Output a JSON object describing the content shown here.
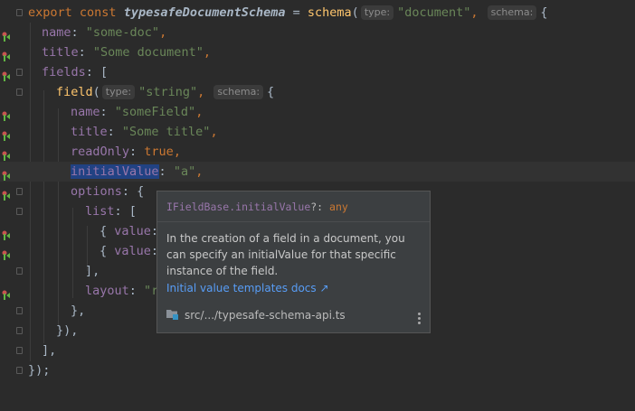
{
  "code_lines": [
    {
      "tokens": [
        {
          "t": "export ",
          "c": "kw"
        },
        {
          "t": "const ",
          "c": "kw"
        },
        {
          "t": "typesafeDocumentSchema",
          "c": "fn-italic"
        },
        {
          "t": " = ",
          "c": "plain"
        },
        {
          "t": "schema",
          "c": "fn"
        },
        {
          "t": "(",
          "c": "plain"
        },
        {
          "t": "type:",
          "c": "hint"
        },
        {
          "t": "\"document\"",
          "c": "str"
        },
        {
          "t": ", ",
          "c": "kw"
        },
        {
          "t": "schema:",
          "c": "hint"
        },
        {
          "t": "{",
          "c": "plain"
        }
      ]
    },
    {
      "tokens": [
        {
          "t": "name",
          "c": "prop"
        },
        {
          "t": ": ",
          "c": "plain"
        },
        {
          "t": "\"some-doc\"",
          "c": "str"
        },
        {
          "t": ",",
          "c": "kw"
        }
      ]
    },
    {
      "tokens": [
        {
          "t": "title",
          "c": "prop"
        },
        {
          "t": ": ",
          "c": "plain"
        },
        {
          "t": "\"Some document\"",
          "c": "str"
        },
        {
          "t": ",",
          "c": "kw"
        }
      ]
    },
    {
      "tokens": [
        {
          "t": "fields",
          "c": "prop"
        },
        {
          "t": ": [",
          "c": "plain"
        }
      ]
    },
    {
      "tokens": [
        {
          "t": "field",
          "c": "fn"
        },
        {
          "t": "(",
          "c": "plain"
        },
        {
          "t": "type:",
          "c": "hint"
        },
        {
          "t": "\"string\"",
          "c": "str"
        },
        {
          "t": ", ",
          "c": "kw"
        },
        {
          "t": "schema:",
          "c": "hint"
        },
        {
          "t": "{",
          "c": "plain"
        }
      ]
    },
    {
      "tokens": [
        {
          "t": "name",
          "c": "prop"
        },
        {
          "t": ": ",
          "c": "plain"
        },
        {
          "t": "\"someField\"",
          "c": "str"
        },
        {
          "t": ",",
          "c": "kw"
        }
      ]
    },
    {
      "tokens": [
        {
          "t": "title",
          "c": "prop"
        },
        {
          "t": ": ",
          "c": "plain"
        },
        {
          "t": "\"Some title\"",
          "c": "str"
        },
        {
          "t": ",",
          "c": "kw"
        }
      ]
    },
    {
      "tokens": [
        {
          "t": "readOnly",
          "c": "prop"
        },
        {
          "t": ": ",
          "c": "plain"
        },
        {
          "t": "true",
          "c": "kw"
        },
        {
          "t": ",",
          "c": "kw"
        }
      ]
    },
    {
      "tokens": [
        {
          "t": "initialValue",
          "c": "prop sel"
        },
        {
          "t": ": ",
          "c": "plain"
        },
        {
          "t": "\"a\"",
          "c": "str"
        },
        {
          "t": ",",
          "c": "kw"
        }
      ]
    },
    {
      "tokens": [
        {
          "t": "options",
          "c": "prop"
        },
        {
          "t": ": {",
          "c": "plain"
        }
      ]
    },
    {
      "tokens": [
        {
          "t": "list",
          "c": "prop"
        },
        {
          "t": ": [",
          "c": "plain"
        }
      ]
    },
    {
      "tokens": [
        {
          "t": "{ ",
          "c": "plain"
        },
        {
          "t": "value",
          "c": "prop"
        },
        {
          "t": ":",
          "c": "plain"
        }
      ]
    },
    {
      "tokens": [
        {
          "t": "{ ",
          "c": "plain"
        },
        {
          "t": "value",
          "c": "prop"
        },
        {
          "t": ":",
          "c": "plain"
        }
      ]
    },
    {
      "tokens": [
        {
          "t": "],",
          "c": "plain"
        }
      ]
    },
    {
      "tokens": [
        {
          "t": "layout",
          "c": "prop"
        },
        {
          "t": ": ",
          "c": "plain"
        },
        {
          "t": "\"r",
          "c": "str"
        }
      ]
    },
    {
      "tokens": [
        {
          "t": "},",
          "c": "plain"
        }
      ]
    },
    {
      "tokens": [
        {
          "t": "}),",
          "c": "plain"
        }
      ]
    },
    {
      "tokens": [
        {
          "t": "],",
          "c": "plain"
        }
      ]
    },
    {
      "tokens": [
        {
          "t": "});",
          "c": "plain"
        }
      ]
    }
  ],
  "popup": {
    "signature_name": "IFieldBase.initialValue",
    "signature_sep": "?: ",
    "signature_type": "any",
    "description": "In the creation of a field in a document, you can specify an initialValue for that specific instance of the field.",
    "link_label": "Initial value templates docs ↗",
    "file_path": "src/.../typesafe-schema-api.ts",
    "file_icon": "folder-file-icon",
    "menu_icon": "more-vertical-icon"
  },
  "colors": {
    "keyword": "#cc7832",
    "string": "#6a8759",
    "property": "#9876aa",
    "function": "#ffc66d",
    "link": "#589df6",
    "background": "#2b2b2b"
  }
}
